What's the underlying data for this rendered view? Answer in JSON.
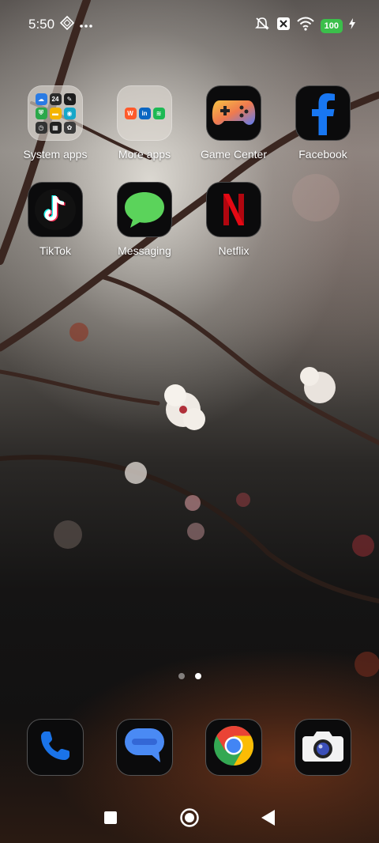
{
  "status_bar": {
    "time": "5:50",
    "battery": "100",
    "icons": [
      "data-saver-icon",
      "more-dots-icon",
      "mute-icon",
      "sim-off-icon",
      "wifi-icon",
      "charging-icon"
    ]
  },
  "home": {
    "row1": [
      {
        "label": "System apps",
        "icon": "folder-icon"
      },
      {
        "label": "More apps",
        "icon": "folder-icon"
      },
      {
        "label": "Game Center",
        "icon": "gamepad-icon"
      },
      {
        "label": "Facebook",
        "icon": "facebook-icon"
      }
    ],
    "row2": [
      {
        "label": "TikTok",
        "icon": "tiktok-icon"
      },
      {
        "label": "Messaging",
        "icon": "chat-bubble-icon"
      },
      {
        "label": "Netflix",
        "icon": "netflix-icon"
      }
    ],
    "system_folder_apps": [
      "24"
    ]
  },
  "page_indicator": {
    "count": 2,
    "active": 2
  },
  "dock": [
    {
      "name": "Phone",
      "icon": "phone-icon"
    },
    {
      "name": "Messages",
      "icon": "messages-icon"
    },
    {
      "name": "Chrome",
      "icon": "chrome-icon"
    },
    {
      "name": "Camera",
      "icon": "camera-icon"
    }
  ],
  "colors": {
    "battery": "#3bbf4b",
    "facebook_blue": "#1877f2",
    "netflix_red": "#e50914",
    "messaging_green": "#5bd35b",
    "phone_blue": "#1a73e8"
  }
}
